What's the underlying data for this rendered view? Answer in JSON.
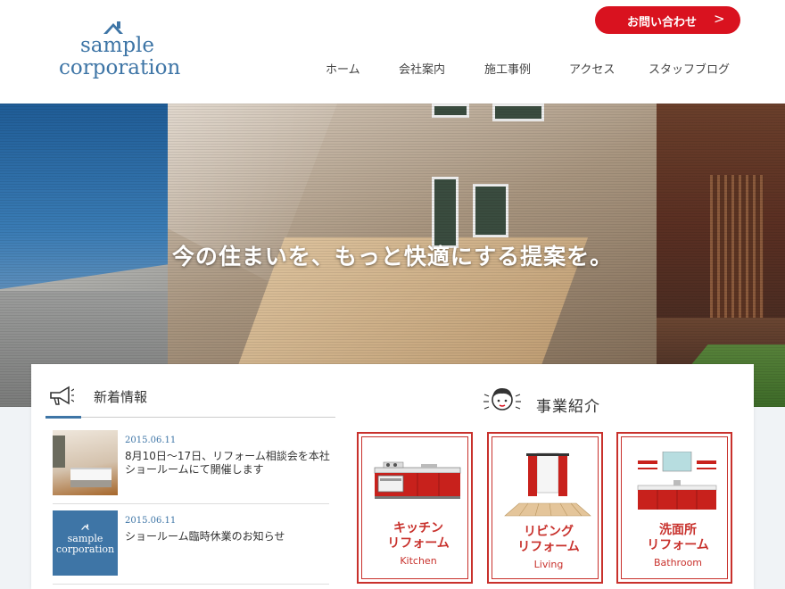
{
  "header": {
    "logo": {
      "line1": "sample",
      "line2": "corporation"
    },
    "contact_button": {
      "label": "お問い合わせ",
      "arrow": ">"
    },
    "nav": [
      {
        "label": "ホーム"
      },
      {
        "label": "会社案内"
      },
      {
        "label": "施工事例"
      },
      {
        "label": "アクセス"
      },
      {
        "label": "スタッフブログ"
      }
    ]
  },
  "hero": {
    "title": "今の住まいを、もっと快適にする提案を。"
  },
  "news": {
    "title": "新着情報",
    "items": [
      {
        "date": "2015.06.11",
        "text": "8月10日〜17日、リフォーム相談会を本社ショールームにて開催します",
        "thumb": "kitchen-photo"
      },
      {
        "date": "2015.06.11",
        "text": "ショールーム臨時休業のお知らせ",
        "thumb": "logo",
        "thumb_logo": {
          "line1": "sample",
          "line2": "corporation"
        }
      }
    ]
  },
  "business": {
    "title": "事業紹介",
    "cards": [
      {
        "jp_line1": "キッチン",
        "jp_line2": "リフォーム",
        "en": "Kitchen",
        "icon": "kitchen-icon"
      },
      {
        "jp_line1": "リビング",
        "jp_line2": "リフォーム",
        "en": "Living",
        "icon": "living-icon"
      },
      {
        "jp_line1": "洗面所",
        "jp_line2": "リフォーム",
        "en": "Bathroom",
        "icon": "bathroom-icon"
      }
    ]
  },
  "colors": {
    "brand_blue": "#3e75a6",
    "accent_red": "#d9121f",
    "card_red": "#c8312c"
  }
}
